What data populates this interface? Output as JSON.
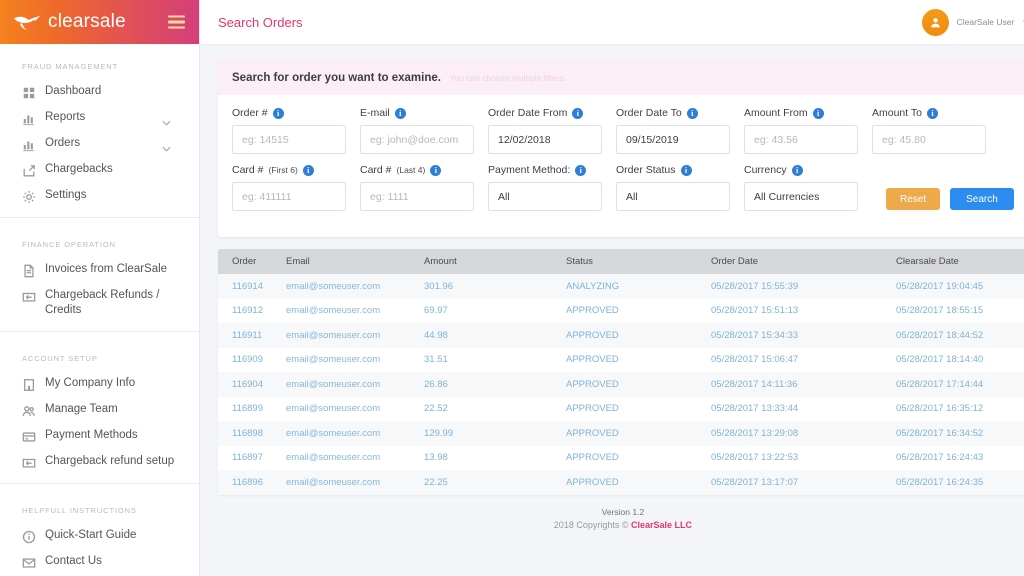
{
  "brand": {
    "name": "clearsale",
    "logo_icon": "bird-logo-icon",
    "menu_icon": "hamburger-menu-icon"
  },
  "sidebar": {
    "groups": [
      {
        "title": "FRAUD MANAGEMENT",
        "items": [
          {
            "label": "Dashboard",
            "icon": "grid-dashboard-icon",
            "caret": ""
          },
          {
            "label": "Reports",
            "icon": "bar-chart-icon",
            "caret": "⌄"
          },
          {
            "label": "Orders",
            "icon": "bar-chart-icon",
            "caret": "⌄"
          },
          {
            "label": "Chargebacks",
            "icon": "share-arrow-icon",
            "caret": ""
          },
          {
            "label": "Settings",
            "icon": "gear-icon",
            "caret": ""
          }
        ]
      },
      {
        "title": "FINANCE OPERATION",
        "items": [
          {
            "label": "Invoices from ClearSale",
            "icon": "document-icon",
            "caret": ""
          },
          {
            "label": "Chargeback Refunds / Credits",
            "icon": "money-return-icon",
            "caret": ""
          }
        ]
      },
      {
        "title": "ACCOUNT SETUP",
        "items": [
          {
            "label": "My Company Info",
            "icon": "building-icon",
            "caret": ""
          },
          {
            "label": "Manage Team",
            "icon": "people-icon",
            "caret": ""
          },
          {
            "label": "Payment Methods",
            "icon": "credit-card-icon",
            "caret": ""
          },
          {
            "label": "Chargeback refund setup",
            "icon": "money-return-icon",
            "caret": ""
          }
        ]
      },
      {
        "title": "HELPFULL INSTRUCTIONS",
        "items": [
          {
            "label": "Quick-Start Guide",
            "icon": "info-circle-icon",
            "caret": ""
          },
          {
            "label": "Contact Us",
            "icon": "envelope-icon",
            "caret": ""
          }
        ]
      }
    ]
  },
  "topbar": {
    "title": "Search Orders",
    "user_name": "ClearSale User",
    "avatar_icon": "user-avatar-icon",
    "caret_icon": "chevron-down-icon"
  },
  "search_panel": {
    "heading": "Search for order you want to examine.",
    "subheading": "You can choose multiple filters.",
    "fields": [
      {
        "label": "Order #",
        "label_small": "",
        "value": "",
        "placeholder": "eg: 14515",
        "type": "text"
      },
      {
        "label": "E-mail",
        "label_small": "",
        "value": "",
        "placeholder": "eg: john@doe.com",
        "type": "text"
      },
      {
        "label": "Order Date From",
        "label_small": "",
        "value": "12/02/2018",
        "placeholder": "",
        "type": "date"
      },
      {
        "label": "Order Date To",
        "label_small": "",
        "value": "09/15/2019",
        "placeholder": "",
        "type": "date"
      },
      {
        "label": "Amount From",
        "label_small": "",
        "value": "",
        "placeholder": "eg: 43.56",
        "type": "text"
      },
      {
        "label": "Amount To",
        "label_small": "",
        "value": "",
        "placeholder": "eg: 45.80",
        "type": "text"
      },
      {
        "label": "Card #",
        "label_small": "(First 6)",
        "value": "",
        "placeholder": "eg: 411111",
        "type": "text"
      },
      {
        "label": "Card #",
        "label_small": "(Last 4)",
        "value": "",
        "placeholder": "eg: 1111",
        "type": "text"
      },
      {
        "label": "Payment Method:",
        "label_small": "",
        "value": "All",
        "placeholder": "",
        "type": "select"
      },
      {
        "label": "Order Status",
        "label_small": "",
        "value": "All",
        "placeholder": "",
        "type": "select"
      },
      {
        "label": "Currency",
        "label_small": "",
        "value": "All Currencies",
        "placeholder": "",
        "type": "select"
      }
    ],
    "reset_label": "Reset",
    "search_label": "Search",
    "info_icon": "info-tooltip-icon",
    "colors": {
      "reset": "#eda94a",
      "search": "#2c8cf0",
      "info": "#2e7dd7",
      "header_bg": "#fbeef4"
    }
  },
  "results_table": {
    "columns": [
      "Order",
      "Email",
      "Amount",
      "Status",
      "Order Date",
      "Clearsale Date"
    ],
    "rows": [
      [
        "116914",
        "email@someuser.com",
        "301.96",
        "ANALYZING",
        "05/28/2017 15:55:39",
        "05/28/2017 19:04:45"
      ],
      [
        "116912",
        "email@someuser.com",
        "69.97",
        "APPROVED",
        "05/28/2017 15:51:13",
        "05/28/2017 18:55:15"
      ],
      [
        "116911",
        "email@someuser.com",
        "44.98",
        "APPROVED",
        "05/28/2017 15:34:33",
        "05/28/2017 18:44:52"
      ],
      [
        "116909",
        "email@someuser.com",
        "31.51",
        "APPROVED",
        "05/28/2017 15:06:47",
        "05/28/2017 18:14:40"
      ],
      [
        "116904",
        "email@someuser.com",
        "26.86",
        "APPROVED",
        "05/28/2017 14:11:36",
        "05/28/2017 17:14:44"
      ],
      [
        "116899",
        "email@someuser.com",
        "22.52",
        "APPROVED",
        "05/28/2017 13:33:44",
        "05/28/2017 16:35:12"
      ],
      [
        "116898",
        "email@someuser.com",
        "129.99",
        "APPROVED",
        "05/28/2017 13:29:08",
        "05/28/2017 16:34:52"
      ],
      [
        "116897",
        "email@someuser.com",
        "13.98",
        "APPROVED",
        "05/28/2017 13:22:53",
        "05/28/2017 16:24:43"
      ],
      [
        "116896",
        "email@someuser.com",
        "22.25",
        "APPROVED",
        "05/28/2017 13:17:07",
        "05/28/2017 16:24:35"
      ]
    ]
  },
  "footer": {
    "version": "Version 1.2",
    "copyright_prefix": "2018 Copyrights © ",
    "copyright_brand": "ClearSale LLC"
  }
}
